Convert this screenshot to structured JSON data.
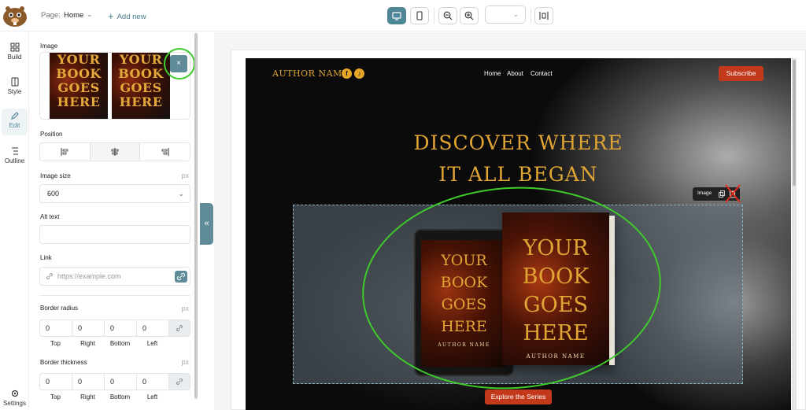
{
  "topbar": {
    "page_label": "Page:",
    "page_value": "Home",
    "add_new": "Add new"
  },
  "nav": {
    "build": "Build",
    "style": "Style",
    "edit": "Edit",
    "outline": "Outline",
    "settings": "Settings"
  },
  "panel": {
    "image_label": "Image",
    "thumb_text": [
      "YOUR",
      "BOOK",
      "GOES",
      "HERE"
    ],
    "close_symbol": "×",
    "position_label": "Position",
    "image_size_label": "Image size",
    "image_size_unit": "px",
    "image_size_value": "600",
    "alt_text_label": "Alt text",
    "link_label": "Link",
    "link_placeholder": "https://example.com",
    "border_radius_label": "Border radius",
    "border_radius_unit": "px",
    "border_radius_values": [
      "0",
      "0",
      "0",
      "0"
    ],
    "side_labels": [
      "Top",
      "Right",
      "Bottom",
      "Left"
    ],
    "border_thickness_label": "Border thickness",
    "border_thickness_unit": "px",
    "border_thickness_values": [
      "0",
      "0",
      "0",
      "0"
    ],
    "collapse_symbol": "«"
  },
  "site": {
    "brand": "AUTHOR NAME",
    "social": [
      "f",
      "♪"
    ],
    "menu": [
      "Home",
      "About",
      "Contact"
    ],
    "subscribe": "Subscribe",
    "headline_line1": "DISCOVER WHERE",
    "headline_line2": "IT ALL BEGAN",
    "image_tooltip": "Image",
    "cover_lines": [
      "YOUR",
      "BOOK",
      "GOES",
      "HERE"
    ],
    "cover_author": "AUTHOR NAME",
    "explore": "Explore the Series"
  },
  "colors": {
    "accent": "#4c8697",
    "brand_gold": "#e0a534",
    "cta_red": "#c3391b",
    "highlight_green": "#3fcb2c",
    "delete_red": "#e0301e"
  }
}
